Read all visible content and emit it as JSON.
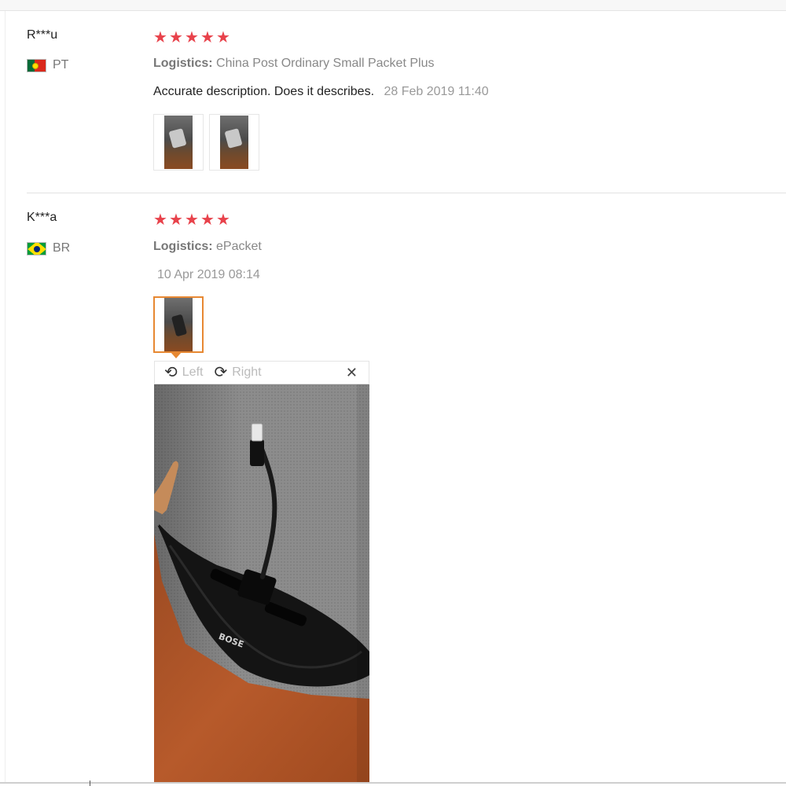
{
  "reviews": [
    {
      "user": "R***u",
      "country": "PT",
      "flag_icon": "portugal-flag-icon",
      "stars": 5,
      "logistics_label": "Logistics:",
      "logistics_value": "China Post Ordinary Small Packet Plus",
      "comment": "Accurate description. Does it describes.",
      "date": "28 Feb 2019 11:40",
      "photo_count": 2
    },
    {
      "user": "K***a",
      "country": "BR",
      "flag_icon": "brazil-flag-icon",
      "stars": 5,
      "logistics_label": "Logistics:",
      "logistics_value": "ePacket",
      "comment": "",
      "date": "10 Apr 2019 08:14",
      "photo_count": 1
    }
  ],
  "star_glyph": "★",
  "star_color": "#e8424b",
  "active_thumb_color": "#e78832",
  "viewer": {
    "rotate_left_label": "Left",
    "rotate_right_label": "Right",
    "rotate_left_icon": "rotate-left-icon",
    "rotate_right_icon": "rotate-right-icon",
    "close_icon": "close-icon",
    "close_glyph": "✕",
    "image_logo_text": "BOSE"
  }
}
